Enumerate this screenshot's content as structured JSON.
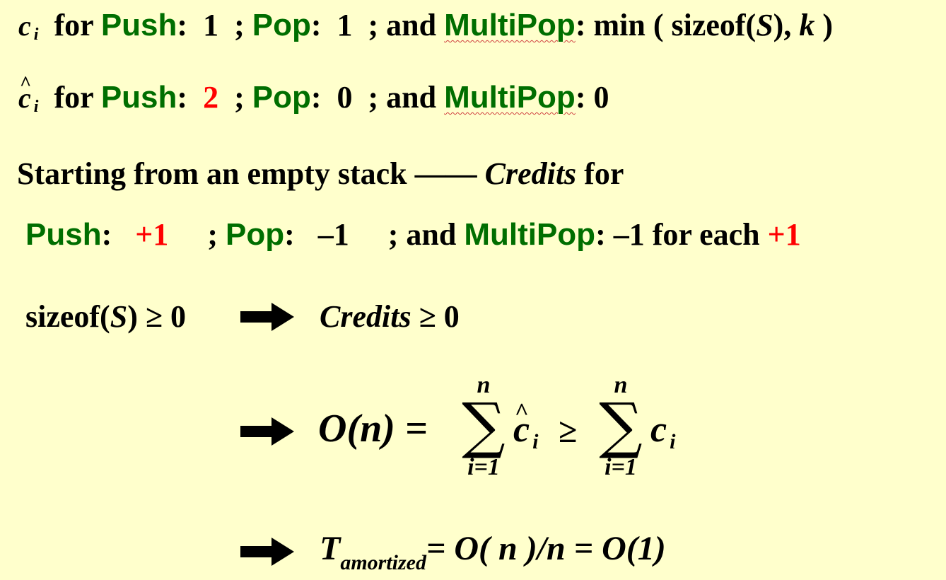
{
  "line1": {
    "var": "c",
    "sub": "i",
    "for": "for",
    "push": "Push",
    "colon1": ":",
    "push_cost": "1",
    "sep1": ";",
    "pop": "Pop",
    "colon2": ":",
    "pop_cost": "1",
    "sep2": "; and",
    "multipop": "MultiPop",
    "colon3": ":",
    "multipop_cost_pre": "min ( sizeof(",
    "multipop_cost_S": "S",
    "multipop_cost_mid": "),",
    "multipop_cost_k": "k",
    "multipop_cost_post": ")"
  },
  "line2": {
    "var": "c",
    "hat": "^",
    "sub": "i",
    "for": "for",
    "push": "Push",
    "colon1": ":",
    "push_cost": "2",
    "sep1": ";",
    "pop": "Pop",
    "colon2": ":",
    "pop_cost": "0",
    "sep2": "; and",
    "multipop": "MultiPop",
    "colon3": ":",
    "multipop_cost": "0"
  },
  "line3": {
    "text": "Starting from an empty stack ——",
    "credits": "Credits",
    "for": "for"
  },
  "line4": {
    "push": "Push",
    "colon1": ":",
    "push_credit": "+1",
    "sep1": ";",
    "pop": "Pop",
    "colon2": ":",
    "pop_credit": "–1",
    "sep2": "; and",
    "multipop": "MultiPop",
    "colon3": ":",
    "multipop_credit": "–1 for each",
    "multipop_plus": "+1"
  },
  "line5": {
    "left_pre": "sizeof(",
    "left_S": "S",
    "left_post": ") ≥ 0",
    "credits": "Credits",
    "right": " ≥ 0"
  },
  "line6": {
    "lhs": "O(n) =",
    "sum_sign": "∑",
    "upper": "n",
    "lower": "i=1",
    "term1_var": "c",
    "term1_hat": "^",
    "term1_sub": "i",
    "ge": "≥",
    "term2_var": "c",
    "term2_sub": "i"
  },
  "line7": {
    "T": "T",
    "sub": "amortized",
    "rest": "= O( n )/n = O(1)"
  },
  "colors": {
    "background": "#ffffcc",
    "keyword_green": "#006e00",
    "highlight_red": "#ff0000"
  },
  "icons": [
    "right-arrow-icon"
  ]
}
